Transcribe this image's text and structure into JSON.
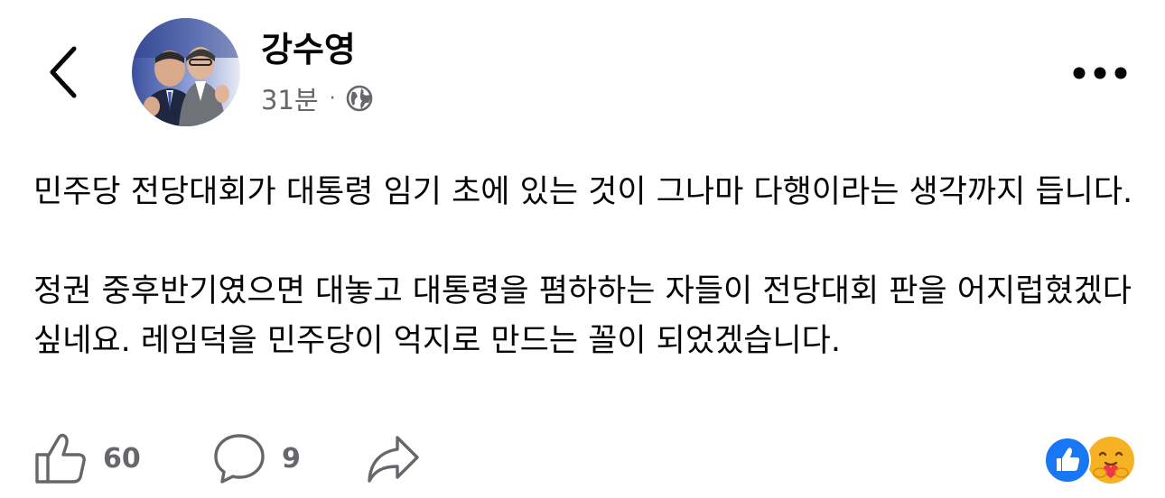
{
  "header": {
    "back_icon": "chevron-left-icon",
    "more_icon": "more-horizontal-icon"
  },
  "author": {
    "name": "강수영",
    "time_ago": "31분",
    "separator": "·",
    "privacy_icon": "globe-icon"
  },
  "post": {
    "paragraphs": [
      "민주당 전당대회가 대통령 임기 초에 있는 것이 그나마 다행이라는 생각까지 듭니다.",
      "정권 중후반기였으면 대놓고 대통령을 폄하하는 자들이 전당대회 판을 어지럽혔겠다 싶네요. 레임덕을 민주당이 억지로 만드는 꼴이 되었겠습니다."
    ]
  },
  "actions": {
    "like": {
      "icon": "thumbs-up-icon",
      "count": "60"
    },
    "comment": {
      "icon": "comment-bubble-icon",
      "count": "9"
    },
    "share": {
      "icon": "share-arrow-icon"
    }
  },
  "reactions": [
    {
      "icon": "like-reaction-icon",
      "color": "#1877f2"
    },
    {
      "icon": "care-reaction-icon",
      "color": "#f7b125"
    }
  ],
  "colors": {
    "text_primary": "#050505",
    "text_secondary": "#65676b",
    "accent": "#1877f2"
  }
}
